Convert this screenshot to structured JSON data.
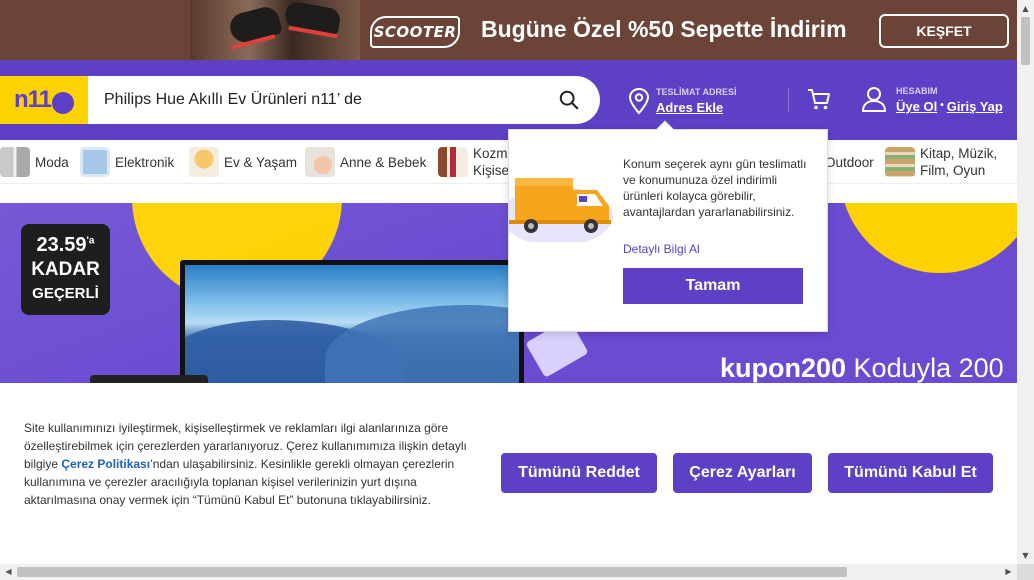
{
  "promo": {
    "logo": "SCOOTER",
    "text": "Bugüne Özel %50 Sepette İndirim",
    "button": "KEŞFET"
  },
  "header": {
    "search_value": "Philips Hue Akıllı Ev Ürünleri n11’ de",
    "delivery_label": "TESLİMAT ADRESİ",
    "delivery_link": "Adres Ekle",
    "account_label": "HESABIM",
    "signup": "Üye Ol",
    "separator": "•",
    "login": "Giriş Yap",
    "brand_color": "#5e40c6",
    "accent_color": "#fed100"
  },
  "categories": [
    {
      "label": "Moda",
      "icon": "fashion-thumb"
    },
    {
      "label": "Elektronik",
      "icon": "electronics-thumb"
    },
    {
      "label": "Ev & Yaşam",
      "icon": "home-lamp-thumb"
    },
    {
      "label": "Anne & Bebek",
      "icon": "baby-thumb"
    },
    {
      "label": "Kozmetik & Kişisel",
      "icon": "cosmetics-thumb",
      "line1": "Kozm",
      "line2": "Kişise"
    },
    {
      "label": "Outdoor",
      "icon": "outdoor-thumb"
    },
    {
      "label": "Kitap, Müzik, Film, Oyun",
      "icon": "books-thumb",
      "line1": "Kitap, Müzik,",
      "line2": "Film, Oyun"
    }
  ],
  "hero": {
    "badge_time": "23.59",
    "badge_suffix": "'a",
    "badge_line2": "KADAR",
    "badge_line3": "GEÇERLİ",
    "coupon_code": "kupon200",
    "coupon_text": " Koduyla 200"
  },
  "popover": {
    "text": "Konum seçerek aynı gün teslimatlı ve konumunuza özel indirimli ürünleri kolayca görebilir, avantajlardan yararlanabilirsiniz.",
    "link": "Detaylı Bilgi Al",
    "button": "Tamam"
  },
  "cookie": {
    "text_before": "Site kullanımınızı iyileştirmek, kişiselleştirmek ve reklamları ilgi alanlarınıza göre özelleştirebilmek için çerezlerden yararlanıyoruz. Çerez kullanımımıza ilişkin detaylı bilgiye ",
    "policy_link": "Çerez Politikası",
    "text_after": "’ndan ulaşabilirsiniz. Kesinlikle gerekli olmayan çerezlerin kullanımına ve çerezler aracılığıyla toplanan kişisel verilerinizin yurt dışına aktarılmasına onay vermek için “Tümünü Kabul Et” butonuna tıklayabilirsiniz.",
    "reject": "Tümünü Reddet",
    "settings": "Çerez Ayarları",
    "accept": "Tümünü Kabul Et"
  },
  "scrollbar": {
    "up": "▲",
    "down": "▼",
    "left": "◀",
    "right": "▶"
  }
}
